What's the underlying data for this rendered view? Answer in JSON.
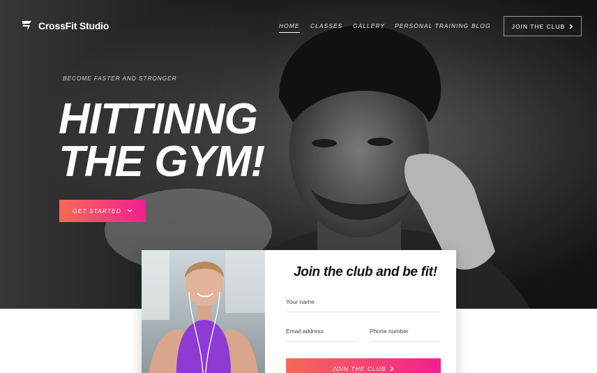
{
  "brand": {
    "name": "CrossFit Studio",
    "icon": "lightning-logo-icon"
  },
  "nav": {
    "items": [
      {
        "label": "HOME",
        "active": true
      },
      {
        "label": "CLASSES",
        "active": false
      },
      {
        "label": "GALLERY",
        "active": false
      },
      {
        "label": "PERSONAL TRAINING",
        "active": false
      },
      {
        "label": "BLOG",
        "active": false
      }
    ],
    "join_button": {
      "label": "JOIN THE CLUB",
      "icon": "chevron-right-icon"
    }
  },
  "hero": {
    "eyebrow": "BECOME FASTER AND STRONGER",
    "headline_line1": "HITTINNG",
    "headline_line2": "THE GYM!",
    "cta": {
      "label": "GET STARTED",
      "icon": "chevron-down-icon"
    }
  },
  "signup": {
    "title": "Join the club and be fit!",
    "name_placeholder": "Your name",
    "email_placeholder": "Email address",
    "phone_placeholder": "Phone number",
    "submit_label": "JOIN THE CLUB",
    "submit_icon": "chevron-right-icon"
  },
  "colors": {
    "accent_start": "#f56a55",
    "accent_end": "#f2208f",
    "hero_bg": "#1b1b1b"
  }
}
